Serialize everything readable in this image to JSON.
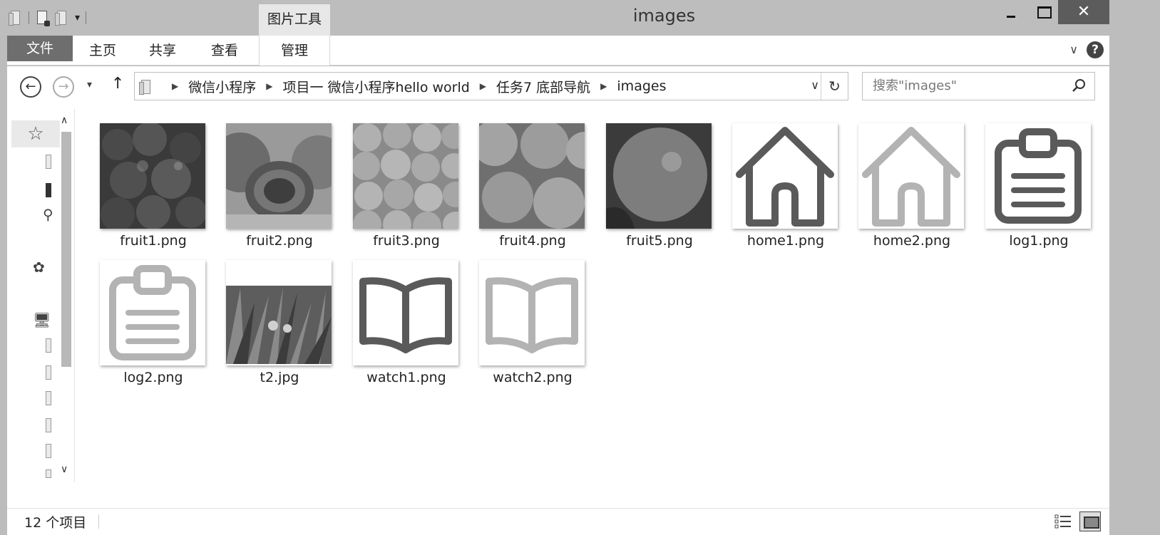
{
  "window": {
    "title": "images"
  },
  "quick_access": {
    "drop_label": "▾"
  },
  "context_tab": {
    "label": "图片工具"
  },
  "ribbon": {
    "file": "文件",
    "home": "主页",
    "share": "共享",
    "view": "查看",
    "manage": "管理"
  },
  "window_buttons": {
    "close": "✕"
  },
  "navigation": {
    "breadcrumbs": [
      "微信小程序",
      "项目一 微信小程序hello world",
      "任务7 底部导航",
      "images"
    ],
    "search_placeholder": "搜索\"images\""
  },
  "files": [
    {
      "name": "fruit1.png",
      "thumb": "fruit1"
    },
    {
      "name": "fruit2.png",
      "thumb": "fruit2"
    },
    {
      "name": "fruit3.png",
      "thumb": "fruit3"
    },
    {
      "name": "fruit4.png",
      "thumb": "fruit4"
    },
    {
      "name": "fruit5.png",
      "thumb": "fruit5"
    },
    {
      "name": "home1.png",
      "thumb": "home-dark"
    },
    {
      "name": "home2.png",
      "thumb": "home-light"
    },
    {
      "name": "log1.png",
      "thumb": "clipboard-dark"
    },
    {
      "name": "log2.png",
      "thumb": "clipboard-light"
    },
    {
      "name": "t2.jpg",
      "thumb": "grass"
    },
    {
      "name": "watch1.png",
      "thumb": "book-dark"
    },
    {
      "name": "watch2.png",
      "thumb": "book-light"
    }
  ],
  "status": {
    "item_count": "12 个项目"
  },
  "colors": {
    "dark_icon": "#5a5a5a",
    "light_icon": "#b3b3b3"
  }
}
